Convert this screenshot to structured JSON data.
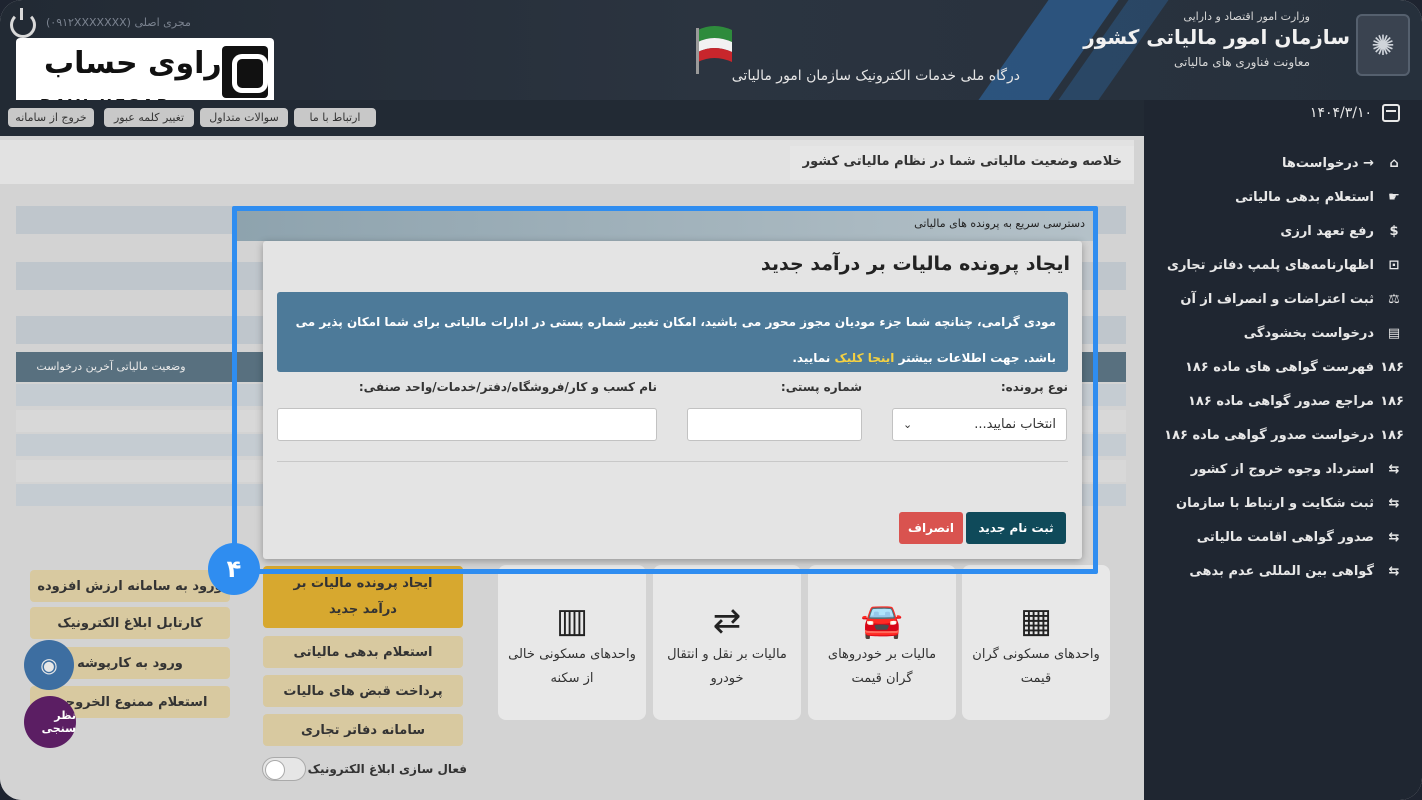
{
  "header": {
    "org_line1": "وزارت امور اقتصاد و دارایی",
    "org_name": "سازمان امور مالیاتی کشور",
    "org_line3": "معاونت فناوری های مالیاتی",
    "portal_title": "درگاه ملی خدمات الکترونیک سازمان امور مالیاتی",
    "user_text": "(۰۹۱۲XXXXXXX) مجری اصلی",
    "emblem_icon": "emblem-icon",
    "accent_color": "#2f6fb0"
  },
  "brand": {
    "fa": "راوی حساب",
    "en": "RAVI HESAB"
  },
  "topnav": {
    "items": [
      "ارتباط با ما",
      "سوالات متداول",
      "تغییر کلمه عبور",
      "خروج از سامانه"
    ]
  },
  "sidebar": {
    "date": "۱۴۰۴/۳/۱۰",
    "requests": "درخواست‌ها",
    "items": [
      {
        "label": "استعلام بدهی مالیاتی",
        "icon": "hand-icon"
      },
      {
        "label": "رفع تعهد ارزی",
        "icon": "dollar-icon"
      },
      {
        "label": "اظهارنامه‌های پلمپ دفاتر تجاری",
        "icon": "lock-icon"
      },
      {
        "label": "ثبت اعتراضات و انصراف از آن",
        "icon": "gavel-icon"
      },
      {
        "label": "درخواست بخشودگی",
        "icon": "doc-icon"
      },
      {
        "label": "فهرست گواهی های ماده ۱۸۶",
        "icon": "186-icon"
      },
      {
        "label": "مراجع صدور گواهی ماده ۱۸۶",
        "icon": "186-icon"
      },
      {
        "label": "درخواست صدور گواهی ماده ۱۸۶",
        "icon": "186-icon"
      },
      {
        "label": "استرداد وجوه خروج از کشور",
        "icon": "exchange-icon"
      },
      {
        "label": "ثبت شکایت و ارتباط با سازمان",
        "icon": "exchange-icon"
      },
      {
        "label": "صدور گواهی اقامت مالیاتی",
        "icon": "exchange-icon"
      },
      {
        "label": "گواهی بین المللی عدم بدهی",
        "icon": "exchange-icon"
      }
    ]
  },
  "main": {
    "summary_title": "خلاصه وضعیت مالیاتی شما در نظام مالیاتی کشور",
    "quick_access": "دسترسی سریع به پرونده های مالیاتی",
    "table_header_status": "وضعیت مالیاتی آخرین درخواست"
  },
  "tiles": [
    {
      "label": "واحدهای مسکونی گران قیمت",
      "icon": "building-icon"
    },
    {
      "label": "مالیات بر خودروهای گران قیمت",
      "icon": "car-icon"
    },
    {
      "label": "مالیات بر نقل و انتقال خودرو",
      "icon": "car-transfer-icon"
    },
    {
      "label": "واحدهای مسکونی خالی از سکنه",
      "icon": "empty-building-icon"
    }
  ],
  "center_buttons": {
    "primary": "ایجاد پرونده مالیات بر درآمد جدید",
    "b1": "استعلام بدهی مالیاتی",
    "b2": "پرداخت قبض های مالیات",
    "b3": "سامانه دفاتر تجاری",
    "toggle_label": "فعال سازی ابلاغ الکترونیک"
  },
  "left_buttons": [
    "ورود به سامانه ارزش افزوده",
    "کارتابل ابلاغ الکترونیک",
    "ورود به کارپوشه",
    "استعلام ممنوع الخروجی"
  ],
  "floating": {
    "survey": "نظر سنجی"
  },
  "step_badge": "۴",
  "modal": {
    "title": "ایجاد پرونده مالیات بر درآمد جدید",
    "alert_text": "مودی گرامی، چنانچه شما جزء مودیان مجوز محور می باشید، امکان تغییر شماره پستی در ادارات مالیاتی برای شما امکان پذیر می باشد. جهت اطلاعات بیشتر",
    "alert_link": "اینجا کلیک",
    "alert_suffix": "نمایید.",
    "type_label": "نوع پرونده:",
    "type_value": "انتخاب نمایید...",
    "postal_label": "شماره پستی:",
    "postal_value": "",
    "business_label": "نام کسب و کار/فروشگاه/دفتر/خدمات/واحد صنفی:",
    "business_value": "",
    "submit": "ثبت نام جدید",
    "cancel": "انصراف"
  }
}
